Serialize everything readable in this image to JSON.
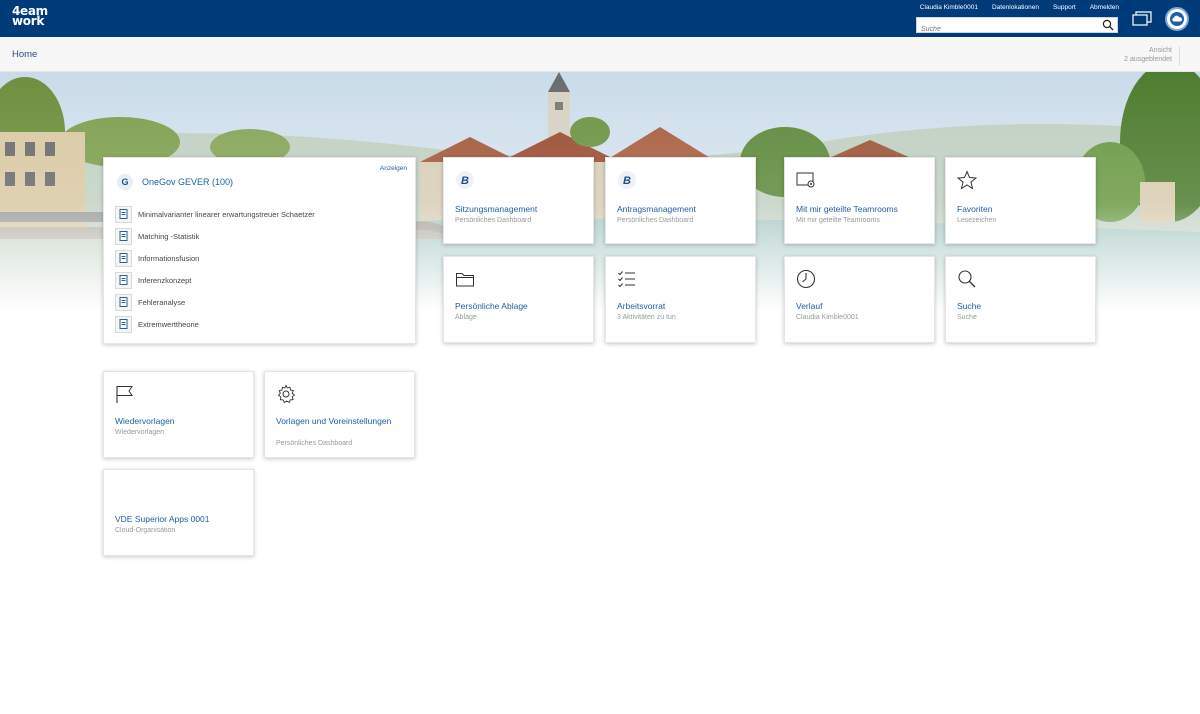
{
  "app": {
    "logo_line1": "4eam",
    "logo_line2": "work"
  },
  "header": {
    "user": "Claudia Kimble0001",
    "links": [
      "Datenlokationen",
      "Support",
      "Abmelden"
    ],
    "search_placeholder": "Suche"
  },
  "breadcrumb": {
    "home": "Home",
    "view_label": "Ansicht",
    "hidden_count": "2 ausgeblendet"
  },
  "gever": {
    "title": "OneGov GEVER (100)",
    "show_label": "Anzeigen",
    "items": [
      "Minimalvarianter linearer erwartungstreuer Schaetzer",
      "Matching -Statistik",
      "Informationsfusion",
      "Inferenzkonzept",
      "Fehleranalyse",
      "Extremwerttheorie"
    ]
  },
  "tiles": {
    "sitzung": {
      "title": "Sitzungsmanagement",
      "sub": "Persönliches Dashboard"
    },
    "antrag": {
      "title": "Antragsmanagement",
      "sub": "Persönliches Dashboard"
    },
    "teamrooms": {
      "title": "Mit mir geteilte Teamrooms",
      "sub": "Mit mir geteilte Teamrooms"
    },
    "favoriten": {
      "title": "Favoriten",
      "sub": "Lesezeichen"
    },
    "ablage": {
      "title": "Persönliche Ablage",
      "sub": "Ablage"
    },
    "arbeitsvorrat": {
      "title": "Arbeitsvorrat",
      "sub": "3 Aktivitäten zu tun"
    },
    "verlauf": {
      "title": "Verlauf",
      "sub": "Claudia Kimble0001"
    },
    "suche": {
      "title": "Suche",
      "sub": "Suche"
    },
    "wiedervorlagen": {
      "title": "Wiedervorlagen",
      "sub": "Wiedervorlagen"
    },
    "vorlagen": {
      "title": "Vorlagen und Voreinstellungen",
      "sub": "Persönliches Dashboard"
    },
    "vde": {
      "title": "VDE Superior Apps 0001",
      "sub": "Cloud-Organisation"
    }
  },
  "colors": {
    "header_bg": "#003b79",
    "link": "#1f5fa6"
  }
}
